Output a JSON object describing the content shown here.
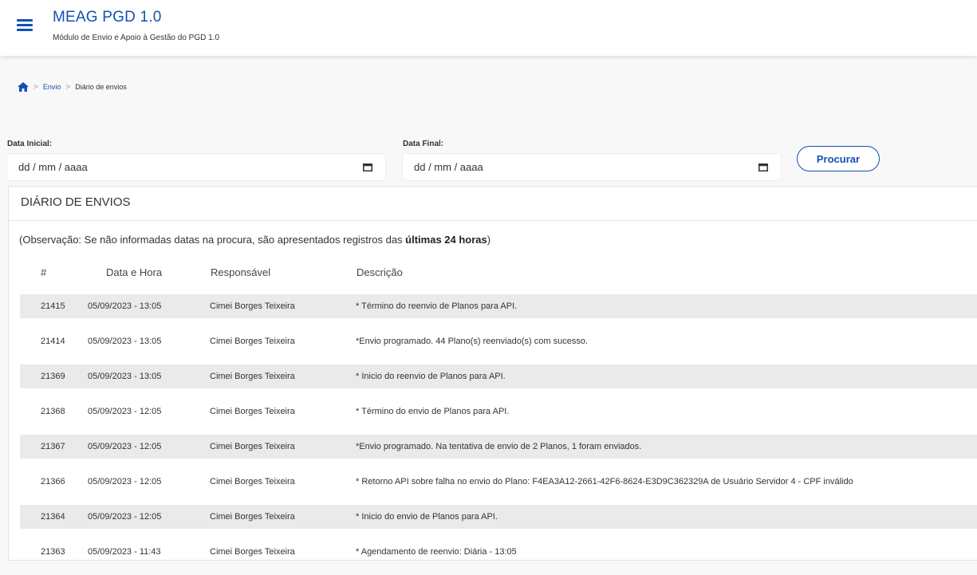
{
  "header": {
    "title": "MEAG PGD 1.0",
    "subtitle": "Módulo de Envio e Apoio à Gestão do PGD 1.0"
  },
  "breadcrumb": {
    "home_icon": "home-icon",
    "items": [
      "Envio",
      "Diário de envios"
    ]
  },
  "filters": {
    "start_label": "Data Inicial:",
    "start_placeholder": "dd / mm / aaaa",
    "end_label": "Data Final:",
    "end_placeholder": "dd / mm / aaaa",
    "search_label": "Procurar"
  },
  "panel": {
    "title": "DIÁRIO DE ENVIOS",
    "note_prefix": "(Observação: Se não informadas datas na procura, são apresentados registros das ",
    "note_bold": "últimas 24 horas",
    "note_suffix": ")",
    "columns": [
      "#",
      "Data e Hora",
      "Responsável",
      "Descrição"
    ],
    "rows": [
      {
        "id": "21415",
        "datetime": "05/09/2023 - 13:05",
        "responsible": "Cimei Borges Teixeira",
        "description": "* Término do reenvio de Planos para API."
      },
      {
        "id": "21414",
        "datetime": "05/09/2023 - 13:05",
        "responsible": "Cimei Borges Teixeira",
        "description": "*Envio programado. 44 Plano(s) reenviado(s) com sucesso."
      },
      {
        "id": "21369",
        "datetime": "05/09/2023 - 13:05",
        "responsible": "Cimei Borges Teixeira",
        "description": "* Inicio do reenvio de Planos para API."
      },
      {
        "id": "21368",
        "datetime": "05/09/2023 - 12:05",
        "responsible": "Cimei Borges Teixeira",
        "description": "* Término do envio de Planos para API."
      },
      {
        "id": "21367",
        "datetime": "05/09/2023 - 12:05",
        "responsible": "Cimei Borges Teixeira",
        "description": "*Envio programado. Na tentativa de envio de 2 Planos, 1 foram enviados."
      },
      {
        "id": "21366",
        "datetime": "05/09/2023 - 12:05",
        "responsible": "Cimei Borges Teixeira",
        "description": "* Retorno API sobre falha no envio do Plano: F4EA3A12-2661-42F6-8624-E3D9C362329A de Usuário Servidor 4 - CPF inválido"
      },
      {
        "id": "21364",
        "datetime": "05/09/2023 - 12:05",
        "responsible": "Cimei Borges Teixeira",
        "description": "* Inicio do envio de Planos para API."
      },
      {
        "id": "21363",
        "datetime": "05/09/2023 - 11:43",
        "responsible": "Cimei Borges Teixeira",
        "description": "* Agendamento de reenvio: Diária - 13:05"
      }
    ]
  },
  "colors": {
    "primary": "#1351b4",
    "row_stripe": "#eaeaea",
    "text": "#333333"
  }
}
